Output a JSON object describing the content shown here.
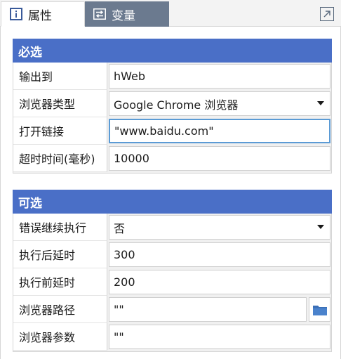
{
  "tabs": [
    {
      "label": "属性",
      "icon": "info-icon"
    },
    {
      "label": "变量",
      "icon": "swap-icon"
    }
  ],
  "colors": {
    "section_header": "#4a6fc7",
    "inactive_tab": "#6b7a8f",
    "focus_border": "#5b9bd5",
    "folder_icon": "#3b6fb6"
  },
  "required": {
    "title": "必选",
    "rows": [
      {
        "label": "输出到",
        "value": "hWeb"
      },
      {
        "label": "浏览器类型",
        "value": "Google Chrome 浏览器"
      },
      {
        "label": "打开链接",
        "value": "\"www.baidu.com\""
      },
      {
        "label": "超时时间(毫秒)",
        "value": "10000"
      }
    ]
  },
  "optional": {
    "title": "可选",
    "rows": [
      {
        "label": "错误继续执行",
        "value": "否"
      },
      {
        "label": "执行后延时",
        "value": "300"
      },
      {
        "label": "执行前延时",
        "value": "200"
      },
      {
        "label": "浏览器路径",
        "value": "\"\""
      },
      {
        "label": "浏览器参数",
        "value": "\"\""
      }
    ]
  }
}
